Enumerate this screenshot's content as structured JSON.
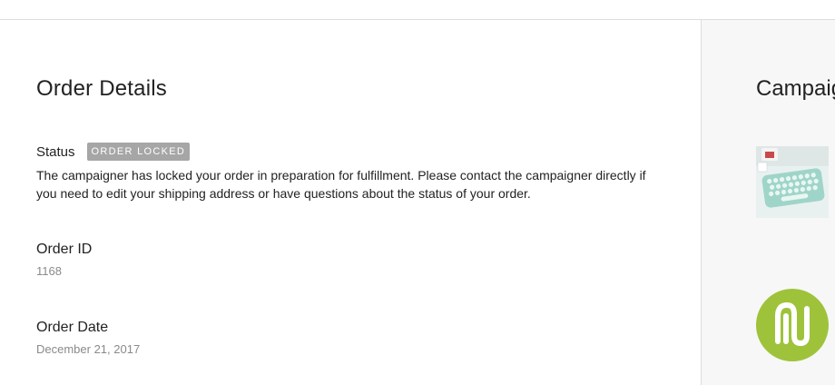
{
  "main": {
    "title": "Order Details",
    "status": {
      "label": "Status",
      "badge": "ORDER LOCKED",
      "description": "The campaigner has locked your order in preparation for fulfillment. Please contact the campaigner directly if you need to edit your shipping address or have questions about the status of your order."
    },
    "order_id": {
      "label": "Order ID",
      "value": "1168"
    },
    "order_date": {
      "label": "Order Date",
      "value": "December 21, 2017"
    }
  },
  "sidebar": {
    "title": "Campaign",
    "thumbnail_icon": "keyboard-product-image",
    "logo_icon": "campaigner-logo",
    "logo_color": "#9ec33b"
  },
  "colors": {
    "badge_bg": "#a6a6a6",
    "muted_text": "#8a8a8a",
    "divider": "#dddddd"
  }
}
